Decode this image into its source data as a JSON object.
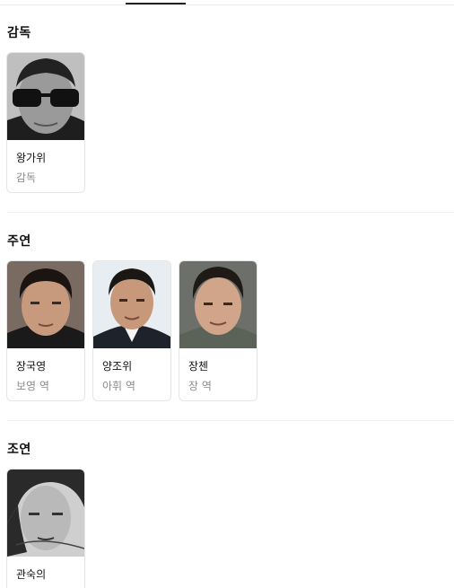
{
  "sections": {
    "director": {
      "title": "감독",
      "people": [
        {
          "name": "왕가위",
          "role": "감독"
        }
      ]
    },
    "lead": {
      "title": "주연",
      "people": [
        {
          "name": "장국영",
          "role": "보영 역"
        },
        {
          "name": "양조위",
          "role": "아휘 역"
        },
        {
          "name": "장첸",
          "role": "장 역"
        }
      ]
    },
    "supporting": {
      "title": "조연",
      "people": [
        {
          "name": "관숙의",
          "role": ""
        }
      ]
    }
  }
}
